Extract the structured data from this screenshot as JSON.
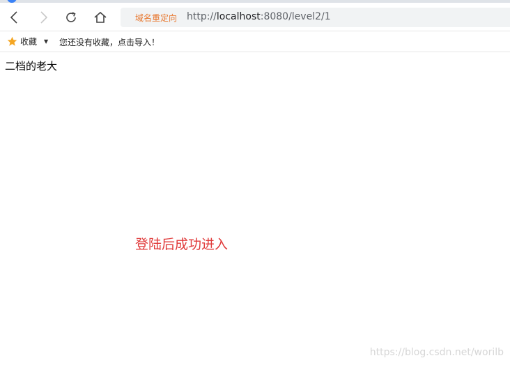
{
  "browser": {
    "icons": {
      "back": "chevron-left-icon",
      "forward": "chevron-right-icon",
      "reload": "reload-icon",
      "home": "home-icon",
      "favorites": "star-icon"
    },
    "address_bar": {
      "redirect_tag": "域名重定向",
      "url_scheme": "http://",
      "url_host": "localhost",
      "url_rest": ":8080/level2/1"
    },
    "bookmarks_bar": {
      "favorites_label": "收藏",
      "empty_hint": "您还没有收藏，点击导入！"
    }
  },
  "page": {
    "heading": "二档的老大",
    "message": "登陆后成功进入"
  },
  "watermark": "https://blog.csdn.net/worilb",
  "colors": {
    "message_red": "#e03a3a",
    "redirect_orange": "#e8772e",
    "star_orange": "#f5a623"
  }
}
